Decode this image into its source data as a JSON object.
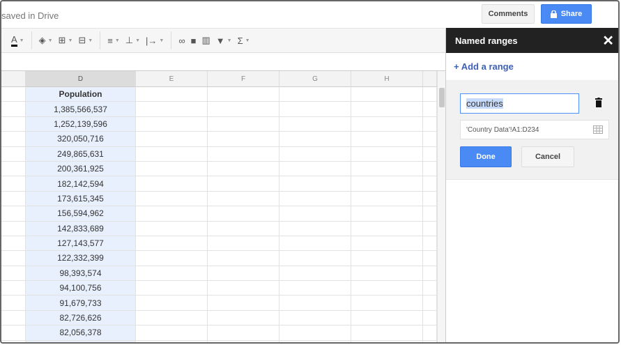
{
  "header": {
    "save_status": "saved in Drive",
    "comments_label": "Comments",
    "share_label": "Share"
  },
  "toolbar": {
    "icons": [
      "text-color-icon",
      "fill-color-icon",
      "borders-icon",
      "merge-icon",
      "align-icon",
      "valign-icon",
      "wrap-icon",
      "link-icon",
      "comment-icon",
      "chart-icon",
      "filter-icon",
      "functions-icon"
    ],
    "text_color_glyph": "A",
    "functions_glyph": "Σ"
  },
  "columns": [
    "D",
    "E",
    "F",
    "G",
    "H"
  ],
  "column_d": {
    "header": "Population",
    "values": [
      "1,385,566,537",
      "1,252,139,596",
      "320,050,716",
      "249,865,631",
      "200,361,925",
      "182,142,594",
      "173,615,345",
      "156,594,962",
      "142,833,689",
      "127,143,577",
      "122,332,399",
      "98,393,574",
      "94,100,756",
      "91,679,733",
      "82,726,626",
      "82,056,378"
    ]
  },
  "sidebar": {
    "title": "Named ranges",
    "close_glyph": "✕",
    "add_label": "+ Add a range",
    "range_name": "countries",
    "range_ref": "'Country Data'!A1:D234",
    "done_label": "Done",
    "cancel_label": "Cancel"
  },
  "colors": {
    "accent": "#4a8af4",
    "selection": "#e8f0fe",
    "sidebar_header": "#222222"
  }
}
